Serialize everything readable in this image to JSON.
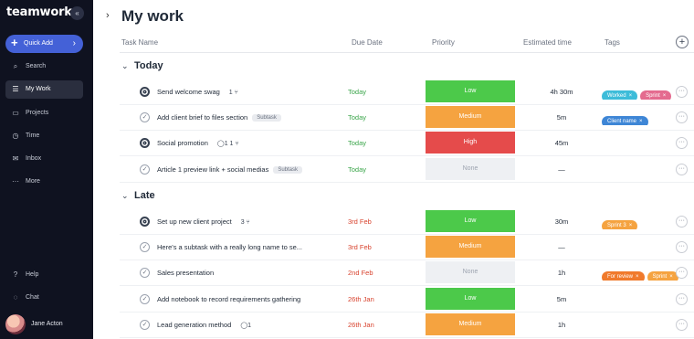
{
  "sidebar": {
    "logo": "teamwork.",
    "collapse": "«",
    "quick_add": {
      "label": "Quick Add",
      "plus": "+",
      "arrow": "›"
    },
    "items": [
      {
        "label": "Search",
        "icon": "⌕"
      },
      {
        "label": "My Work",
        "icon": "☰"
      },
      {
        "label": "Projects",
        "icon": "▭"
      },
      {
        "label": "Time",
        "icon": "◷"
      },
      {
        "label": "Inbox",
        "icon": "✉"
      },
      {
        "label": "More",
        "icon": "···"
      }
    ],
    "bottom_items": [
      {
        "label": "Help",
        "icon": "?"
      },
      {
        "label": "Chat",
        "icon": "◌"
      }
    ],
    "user": {
      "name": "Jane Acton"
    }
  },
  "main": {
    "chevron": "›",
    "title": "My work",
    "columns": {
      "task": "Task Name",
      "due": "Due Date",
      "priority": "Priority",
      "estimate": "Estimated time",
      "tags": "Tags",
      "add": "+"
    },
    "groups": {
      "today": {
        "label": "Today",
        "chevron": "⌄"
      },
      "late": {
        "label": "Late",
        "chevron": "⌄"
      }
    },
    "rows": [
      {
        "name": "Send welcome swag",
        "chip": "",
        "meta": "1 ⑂",
        "due": "Today",
        "priority": "Low",
        "estimate": "4h 30m",
        "tags": [
          {
            "label": "Worked",
            "color": "#3dbcd9"
          },
          {
            "label": "Sprint",
            "color": "#e46b8f"
          }
        ]
      },
      {
        "name": "Add client brief to files section",
        "chip": "Subtask",
        "meta": "",
        "due": "Today",
        "priority": "Medium",
        "estimate": "5m",
        "tags": [
          {
            "label": "Client name",
            "color": "#3e86d6"
          }
        ]
      },
      {
        "name": "Social promotion",
        "chip": "",
        "meta": "◯1     1 ⑂",
        "due": "Today",
        "priority": "High",
        "estimate": "45m",
        "tags": []
      },
      {
        "name": "Article 1 preview link + social medias",
        "chip": "Subtask",
        "meta": "",
        "due": "Today",
        "priority": "None",
        "estimate": "—",
        "tags": []
      },
      {
        "name": "Set up new client project",
        "chip": "",
        "meta": "3 ⑂",
        "due": "3rd Feb",
        "priority": "Low",
        "estimate": "30m",
        "tags": [
          {
            "label": "Sprint 3",
            "color": "#f5a340"
          }
        ]
      },
      {
        "name": "Here's a subtask with a really long name to se...",
        "chip": "",
        "meta": "",
        "due": "3rd Feb",
        "priority": "Medium",
        "estimate": "—",
        "tags": []
      },
      {
        "name": "Sales presentation",
        "chip": "",
        "meta": "",
        "due": "2nd Feb",
        "priority": "None",
        "estimate": "1h",
        "tags": [
          {
            "label": "For review",
            "color": "#f07a2c"
          },
          {
            "label": "Sprint",
            "color": "#f5a340"
          }
        ]
      },
      {
        "name": "Add notebook to record requirements gathering",
        "chip": "",
        "meta": "",
        "due": "26th Jan",
        "priority": "Low",
        "estimate": "5m",
        "tags": []
      },
      {
        "name": "Lead generation method",
        "chip": "",
        "meta": "◯1",
        "due": "26th Jan",
        "priority": "Medium",
        "estimate": "1h",
        "tags": []
      }
    ]
  }
}
